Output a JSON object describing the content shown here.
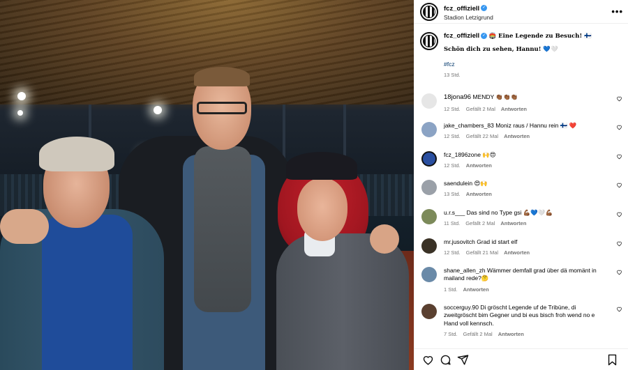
{
  "post": {
    "username": "fcz_offiziell",
    "location": "Stadion Letzigrund",
    "more_label": "•••"
  },
  "caption": {
    "username": "fcz_offiziell",
    "title": "🏟️ 𝐄𝐢𝐧𝐞 𝐋𝐞𝐠𝐞𝐧𝐝𝐞 𝐳𝐮 𝐁𝐞𝐬𝐮𝐜𝐡! 🇫🇮",
    "line2": "𝐒𝐜𝐡ö𝐧 𝐝𝐢𝐜𝐡 𝐳𝐮 𝐬𝐞𝐡𝐞𝐧, 𝐇𝐚𝐧𝐧𝐮! 💙🤍",
    "hashtag": "#fcz",
    "time": "13 Std."
  },
  "comments": [
    {
      "user": "18jona96",
      "text": "MENDY 👏🏾👏🏾👏🏾",
      "time": "12 Std.",
      "likes": "Gefällt 2 Mal",
      "reply": "Antworten",
      "avatar_color": "#e6e6e6"
    },
    {
      "user": "jake_chambers_83",
      "text": "Moniz raus / Hannu rein 🇫🇮 ❤️",
      "time": "12 Std.",
      "likes": "Gefällt 22 Mal",
      "reply": "Antworten",
      "avatar_color": "#8ba3c4"
    },
    {
      "user": "fcz_1896zone",
      "text": "🙌😍",
      "time": "12 Std.",
      "likes": "",
      "reply": "Antworten",
      "avatar_color": "#2a4fa0"
    },
    {
      "user": "saendulein",
      "text": "😍🙌",
      "time": "13 Std.",
      "likes": "",
      "reply": "Antworten",
      "avatar_color": "#9aa0a8"
    },
    {
      "user": "u.r.s___",
      "text": "Das sind no Type gsi 💪🏾💙🤍💪🏾",
      "time": "11 Std.",
      "likes": "Gefällt 2 Mal",
      "reply": "Antworten",
      "avatar_color": "#7c8a5a"
    },
    {
      "user": "mr.jusovitch",
      "text": "Grad id start elf",
      "time": "12 Std.",
      "likes": "Gefällt 21 Mal",
      "reply": "Antworten",
      "avatar_color": "#3a3226"
    },
    {
      "user": "shane_allen_zh",
      "text": "Wämmer demfall grad über dä momänt in mailand rede?🤔",
      "time": "1 Std.",
      "likes": "",
      "reply": "Antworten",
      "avatar_color": "#6a8aa8"
    },
    {
      "user": "soccerguy.90",
      "text": "Di gröscht Legende uf de Tribüne, di zweitgröscht bim Gegner und bi eus bisch froh wend no e Hand voll kennsch.",
      "time": "7 Std.",
      "likes": "Gefällt 2 Mal",
      "reply": "Antworten",
      "avatar_color": "#5a4030"
    }
  ],
  "colors": {
    "link": "#00376b",
    "meta": "#737373",
    "verified": "#3797f0"
  }
}
